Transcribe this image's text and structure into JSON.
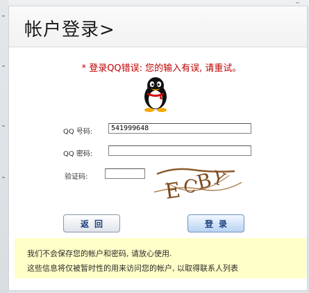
{
  "header": {
    "title": "帐户登录>"
  },
  "error": {
    "message": "* 登录QQ错误: 您的输入有误, 请重试。"
  },
  "form": {
    "qq_number_label": "QQ 号码:",
    "qq_number_value": "541999648",
    "password_label": "QQ 密码:",
    "password_value": "",
    "captcha_label": "验证码:",
    "captcha_value": "",
    "captcha_text": "ECBY"
  },
  "buttons": {
    "back": "返回",
    "login": "登录"
  },
  "notice": {
    "line1": "我们不会保存您的帐户和密码, 请放心使用.",
    "line2": "这些信息将仅被暂时性的用来访问您的帐户, 以取得联系人列表"
  },
  "colors": {
    "error": "#c00000",
    "notice_bg": "#ffffc8",
    "button_text": "#1b3f7a"
  },
  "icons": {
    "logo": "qq-penguin-icon"
  }
}
